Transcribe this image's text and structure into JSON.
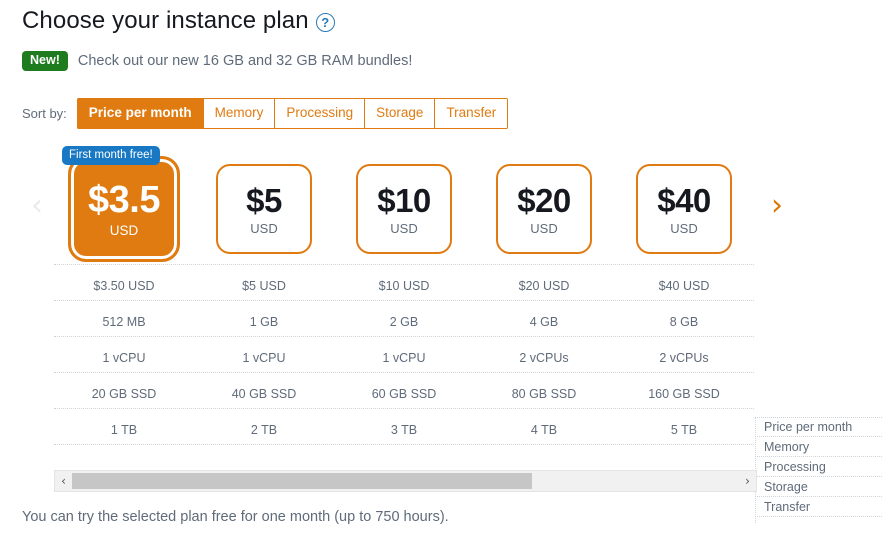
{
  "header": {
    "title": "Choose your instance plan",
    "help_icon": "?",
    "new_badge": "New!",
    "new_text": "Check out our new 16 GB and 32 GB RAM bundles!"
  },
  "sort": {
    "label": "Sort by:",
    "options": [
      {
        "label": "Price per month",
        "active": true
      },
      {
        "label": "Memory",
        "active": false
      },
      {
        "label": "Processing",
        "active": false
      },
      {
        "label": "Storage",
        "active": false
      },
      {
        "label": "Transfer",
        "active": false
      }
    ]
  },
  "carousel": {
    "prev_icon": "‹",
    "next_icon": "›",
    "prev_enabled": false,
    "next_enabled": true
  },
  "spec_labels": [
    "Price per month",
    "Memory",
    "Processing",
    "Storage",
    "Transfer"
  ],
  "plans": [
    {
      "price": "$3.5",
      "currency": "USD",
      "ribbon": "First month free!",
      "selected": true,
      "specs": [
        "$3.50 USD",
        "512 MB",
        "1 vCPU",
        "20 GB SSD",
        "1 TB"
      ]
    },
    {
      "price": "$5",
      "currency": "USD",
      "ribbon": "",
      "selected": false,
      "specs": [
        "$5 USD",
        "1 GB",
        "1 vCPU",
        "40 GB SSD",
        "2 TB"
      ]
    },
    {
      "price": "$10",
      "currency": "USD",
      "ribbon": "",
      "selected": false,
      "specs": [
        "$10 USD",
        "2 GB",
        "1 vCPU",
        "60 GB SSD",
        "3 TB"
      ]
    },
    {
      "price": "$20",
      "currency": "USD",
      "ribbon": "",
      "selected": false,
      "specs": [
        "$20 USD",
        "4 GB",
        "2 vCPUs",
        "80 GB SSD",
        "4 TB"
      ]
    },
    {
      "price": "$40",
      "currency": "USD",
      "ribbon": "",
      "selected": false,
      "specs": [
        "$40 USD",
        "8 GB",
        "2 vCPUs",
        "160 GB SSD",
        "5 TB"
      ]
    }
  ],
  "scrollbar": {
    "left_icon": "‹",
    "right_icon": "›",
    "thumb_percent": 69
  },
  "footer": {
    "note": "You can try the selected plan free for one month (up to 750 hours)."
  },
  "colors": {
    "accent_orange": "#e07b11",
    "badge_green": "#1e7b1e",
    "ribbon_blue": "#1878c4",
    "help_blue": "#2a7ab8",
    "text_gray": "#5f6b7a",
    "text_dark": "#16191f"
  }
}
